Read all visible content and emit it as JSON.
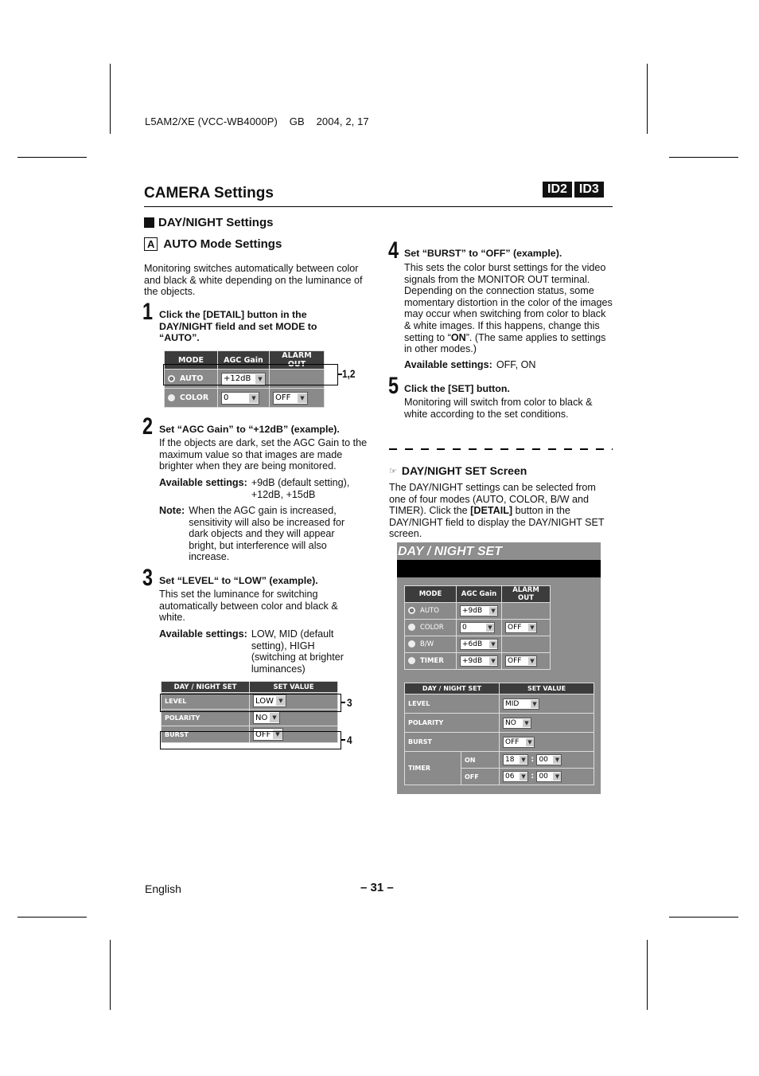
{
  "header": {
    "doc_code": "L5AM2/XE (VCC-WB4000P)    GB    2004, 2, 17",
    "title": "CAMERA Settings",
    "badges": [
      "ID2",
      "ID3"
    ]
  },
  "section": {
    "heading": "DAY/NIGHT Settings",
    "sub_marker": "A",
    "sub_heading": "AUTO Mode Settings",
    "intro": "Monitoring switches automatically between color and black & white depending on the luminance of the objects."
  },
  "steps": [
    {
      "num": "1",
      "title": "Click the [DETAIL] button in the DAY/NIGHT field and set MODE to “AUTO”."
    },
    {
      "num": "2",
      "title": "Set “AGC Gain” to “+12dB” (example).",
      "body": "If the objects are dark, set the AGC Gain to the maximum value so that images are made brighter when they are being monitored.",
      "avail_label": "Available settings:",
      "avail_value": "+9dB (default setting), +12dB, +15dB",
      "note_label": "Note:",
      "note_value": "When the AGC gain is increased, sensitivity will also be increased for dark objects and they will appear bright, but interference will also increase."
    },
    {
      "num": "3",
      "title": "Set “LEVEL“ to “LOW” (example).",
      "body": "This set the luminance for switching automatically between color and black & white.",
      "avail_label": "Available settings:",
      "avail_value": "LOW, MID (default setting), HIGH (switching at brighter luminances)"
    },
    {
      "num": "4",
      "title": "Set “BURST” to “OFF” (example).",
      "body_pre": "This sets the color burst settings for the video signals from the MONITOR OUT terminal. Depending on the connection status, some momentary distortion in the color of the images may occur when switching from color to black & white images. If this happens, change this setting to “",
      "body_bold": "ON",
      "body_post": "”. (The same applies to settings in other modes.)",
      "avail_label": "Available settings:",
      "avail_value": "OFF, ON"
    },
    {
      "num": "5",
      "title": "Click the [SET] button.",
      "body": "Monitoring will switch from color to black & white according to the set conditions."
    }
  ],
  "fig1": {
    "headers": [
      "MODE",
      "AGC Gain",
      "ALARM OUT"
    ],
    "rows": [
      {
        "mode": "AUTO",
        "selected": true,
        "agc": "+12dB",
        "alarm": ""
      },
      {
        "mode": "COLOR",
        "selected": false,
        "agc": "0",
        "alarm": "OFF"
      }
    ],
    "callout": "1,2"
  },
  "fig2": {
    "headers": [
      "DAY / NIGHT SET",
      "SET VALUE"
    ],
    "rows": [
      {
        "label": "LEVEL",
        "value": "LOW"
      },
      {
        "label": "POLARITY",
        "value": "NO"
      },
      {
        "label": "BURST",
        "value": "OFF"
      }
    ],
    "callouts": [
      "3",
      "4"
    ]
  },
  "screen_section": {
    "icon": "pointing-hand-icon",
    "heading": "DAY/NIGHT SET Screen",
    "body_pre": "The DAY/NIGHT settings can be selected from one of four modes (AUTO, COLOR, B/W and TIMER). Click the ",
    "body_bold": "[DETAIL]",
    "body_post": " button in the DAY/NIGHT field to display the DAY/NIGHT SET screen."
  },
  "dn_screen": {
    "title": "DAY / NIGHT SET",
    "mode_headers": [
      "MODE",
      "AGC Gain",
      "ALARM OUT"
    ],
    "modes": [
      {
        "mode": "AUTO",
        "selected": true,
        "agc": "+9dB",
        "alarm": ""
      },
      {
        "mode": "COLOR",
        "selected": false,
        "agc": "0",
        "alarm": "OFF"
      },
      {
        "mode": "B/W",
        "selected": false,
        "agc": "+6dB",
        "alarm": ""
      },
      {
        "mode": "TIMER",
        "selected": false,
        "agc": "+9dB",
        "alarm": "OFF"
      }
    ],
    "set_headers": [
      "DAY / NIGHT SET",
      "SET VALUE"
    ],
    "level_label": "LEVEL",
    "level_value": "MID",
    "polarity_label": "POLARITY",
    "polarity_value": "NO",
    "burst_label": "BURST",
    "burst_value": "OFF",
    "timer_label": "TIMER",
    "timer_on_label": "ON",
    "timer_on_h": "18",
    "timer_on_m": "00",
    "timer_off_label": "OFF",
    "timer_off_h": "06",
    "timer_off_m": "00",
    "colon": ":"
  },
  "footer": {
    "language": "English",
    "page": "– 31 –"
  }
}
